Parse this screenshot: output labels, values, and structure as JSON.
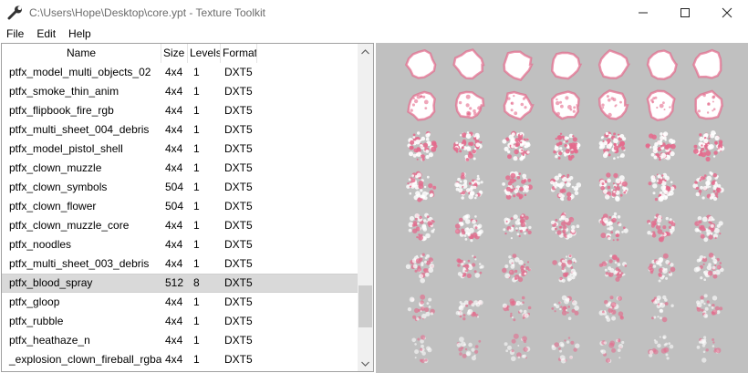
{
  "window": {
    "title": "C:\\Users\\Hope\\Desktop\\core.ypt - Texture Toolkit",
    "icon": "wrench-icon"
  },
  "menu": [
    "File",
    "Edit",
    "Help"
  ],
  "table": {
    "columns": [
      "Name",
      "Size",
      "Levels",
      "Format"
    ],
    "rows": [
      {
        "name": "ptfx_model_multi_objects_02",
        "size": "4x4",
        "levels": "1",
        "format": "DXT5"
      },
      {
        "name": "ptfx_smoke_thin_anim",
        "size": "4x4",
        "levels": "1",
        "format": "DXT5"
      },
      {
        "name": "ptfx_flipbook_fire_rgb",
        "size": "4x4",
        "levels": "1",
        "format": "DXT5"
      },
      {
        "name": "ptfx_multi_sheet_004_debris",
        "size": "4x4",
        "levels": "1",
        "format": "DXT5"
      },
      {
        "name": "ptfx_model_pistol_shell",
        "size": "4x4",
        "levels": "1",
        "format": "DXT5"
      },
      {
        "name": "ptfx_clown_muzzle",
        "size": "4x4",
        "levels": "1",
        "format": "DXT5"
      },
      {
        "name": "ptfx_clown_symbols",
        "size": "504",
        "levels": "1",
        "format": "DXT5"
      },
      {
        "name": "ptfx_clown_flower",
        "size": "504",
        "levels": "1",
        "format": "DXT5"
      },
      {
        "name": "ptfx_clown_muzzle_core",
        "size": "4x4",
        "levels": "1",
        "format": "DXT5"
      },
      {
        "name": "ptfx_noodles",
        "size": "4x4",
        "levels": "1",
        "format": "DXT5"
      },
      {
        "name": "ptfx_multi_sheet_003_debris",
        "size": "4x4",
        "levels": "1",
        "format": "DXT5"
      },
      {
        "name": "ptfx_blood_spray",
        "size": "512",
        "levels": "8",
        "format": "DXT5",
        "selected": true
      },
      {
        "name": "ptfx_gloop",
        "size": "4x4",
        "levels": "1",
        "format": "DXT5"
      },
      {
        "name": "ptfx_rubble",
        "size": "4x4",
        "levels": "1",
        "format": "DXT5"
      },
      {
        "name": "ptfx_heathaze_n",
        "size": "4x4",
        "levels": "1",
        "format": "DXT5"
      },
      {
        "name": "_explosion_clown_fireball_rgba",
        "size": "4x4",
        "levels": "1",
        "format": "DXT5"
      }
    ]
  },
  "preview": {
    "background": "#c0c0c0",
    "sprite_color": "#e46a8c",
    "grid_rows": 8,
    "grid_cols": 7
  }
}
